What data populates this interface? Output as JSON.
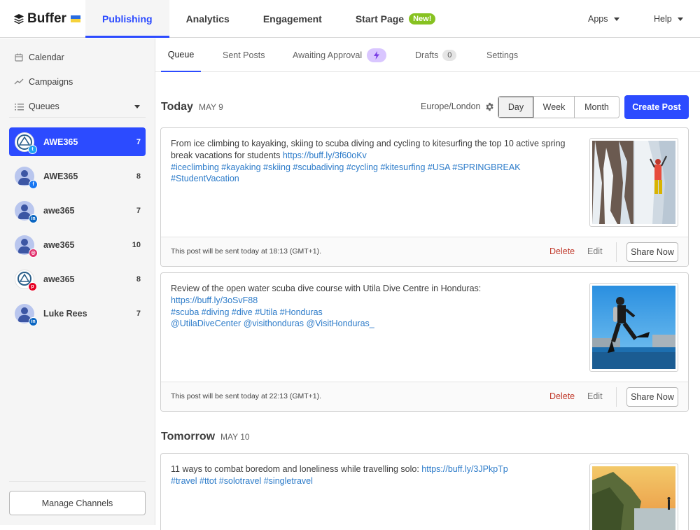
{
  "brand": {
    "name": "Buffer",
    "accent": "#2c4bff"
  },
  "topnav": {
    "tabs": [
      {
        "label": "Publishing",
        "active": true
      },
      {
        "label": "Analytics"
      },
      {
        "label": "Engagement"
      },
      {
        "label": "Start Page",
        "badge": "New!"
      }
    ],
    "apps_label": "Apps",
    "help_label": "Help"
  },
  "sidebar": {
    "links": [
      {
        "label": "Calendar",
        "icon": "calendar-icon"
      },
      {
        "label": "Campaigns",
        "icon": "trend-line-icon"
      },
      {
        "label": "Queues",
        "icon": "list-icon"
      }
    ],
    "channels": [
      {
        "name": "AWE365",
        "count": "7",
        "network": "twitter",
        "active": true
      },
      {
        "name": "AWE365",
        "count": "8",
        "network": "facebook"
      },
      {
        "name": "awe365",
        "count": "7",
        "network": "linkedin"
      },
      {
        "name": "awe365",
        "count": "10",
        "network": "instagram"
      },
      {
        "name": "awe365",
        "count": "8",
        "network": "pinterest"
      },
      {
        "name": "Luke Rees",
        "count": "7",
        "network": "linkedin"
      }
    ],
    "manage_label": "Manage Channels"
  },
  "subtabs": [
    {
      "label": "Queue",
      "active": true
    },
    {
      "label": "Sent Posts"
    },
    {
      "label": "Awaiting Approval",
      "icon": "bolt-icon"
    },
    {
      "label": "Drafts",
      "count": "0"
    },
    {
      "label": "Settings"
    }
  ],
  "toolbar": {
    "timezone": "Europe/London",
    "views": [
      "Day",
      "Week",
      "Month"
    ],
    "active_view": "Day",
    "create_label": "Create Post"
  },
  "days": [
    {
      "title": "Today",
      "date": "MAY 9"
    },
    {
      "title": "Tomorrow",
      "date": "MAY 10"
    }
  ],
  "posts": [
    {
      "text": "From ice climbing to kayaking, skiing to scuba diving and cycling to kitesurfing the top 10 active spring break vacations for students ",
      "link": "https://buff.ly/3f60oKv",
      "hashtags": "#iceclimbing #kayaking #skiing #scubadiving #cycling #kitesurfing #USA #SPRINGBREAK #StudentVacation",
      "schedule": "This post will be sent today at 18:13 (GMT+1).",
      "delete_label": "Delete",
      "edit_label": "Edit",
      "share_label": "Share Now"
    },
    {
      "text": "Review of the open water scuba dive course with Utila Dive Centre in Honduras: ",
      "link": "https://buff.ly/3oSvF88",
      "hashtags": "#scuba #diving #dive #Utila #Honduras",
      "mentions": "@UtilaDiveCenter @visithonduras @VisitHonduras_",
      "schedule": "This post will be sent today at 22:13 (GMT+1).",
      "delete_label": "Delete",
      "edit_label": "Edit",
      "share_label": "Share Now"
    },
    {
      "text": "11 ways to combat boredom and loneliness while travelling solo:  ",
      "link": "https://buff.ly/3JPkpTp",
      "hashtags": "#travel #ttot #solotravel #singletravel"
    }
  ]
}
